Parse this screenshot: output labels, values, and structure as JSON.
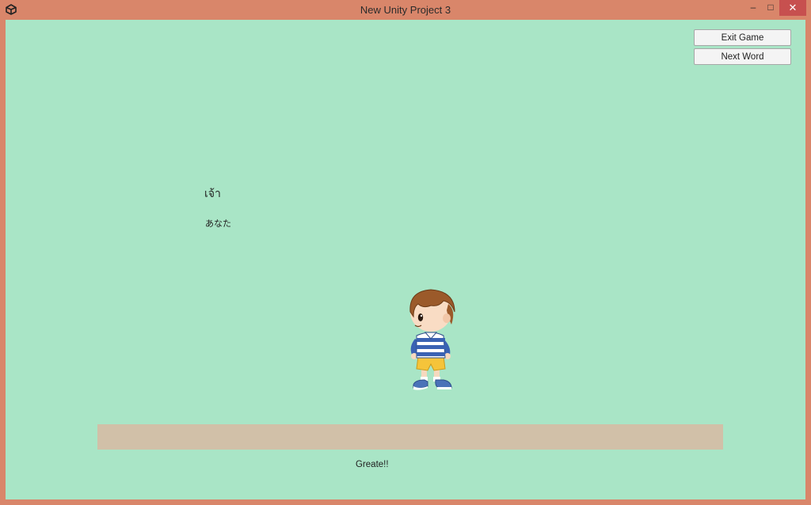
{
  "window": {
    "title": "New Unity Project 3",
    "controls": {
      "minimize": "–",
      "maximize": "□",
      "close": "✕"
    },
    "accent": "#d9866a",
    "close_color": "#c7504f"
  },
  "game": {
    "background": "#a9e5c6",
    "buttons": {
      "exit": "Exit Game",
      "next": "Next Word"
    },
    "word": {
      "thai": "เจ้า",
      "japanese": "あなた"
    },
    "result": "Greate!!",
    "ground_color": "#d1c0a8",
    "character_icon": "boy-walking-sprite"
  }
}
